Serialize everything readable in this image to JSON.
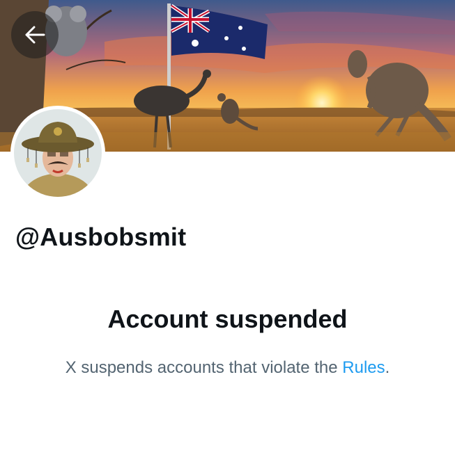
{
  "banner": {
    "description_icon": "australian-outback-banner"
  },
  "nav": {
    "back_icon": "arrow-left-icon"
  },
  "profile": {
    "handle": "@Ausbobsmit"
  },
  "notice": {
    "title": "Account suspended",
    "message_prefix": "X suspends accounts that violate the ",
    "rules_link": "Rules",
    "message_suffix": "."
  },
  "colors": {
    "text_primary": "#0f1419",
    "text_secondary": "#536471",
    "link": "#1d9bf0"
  }
}
